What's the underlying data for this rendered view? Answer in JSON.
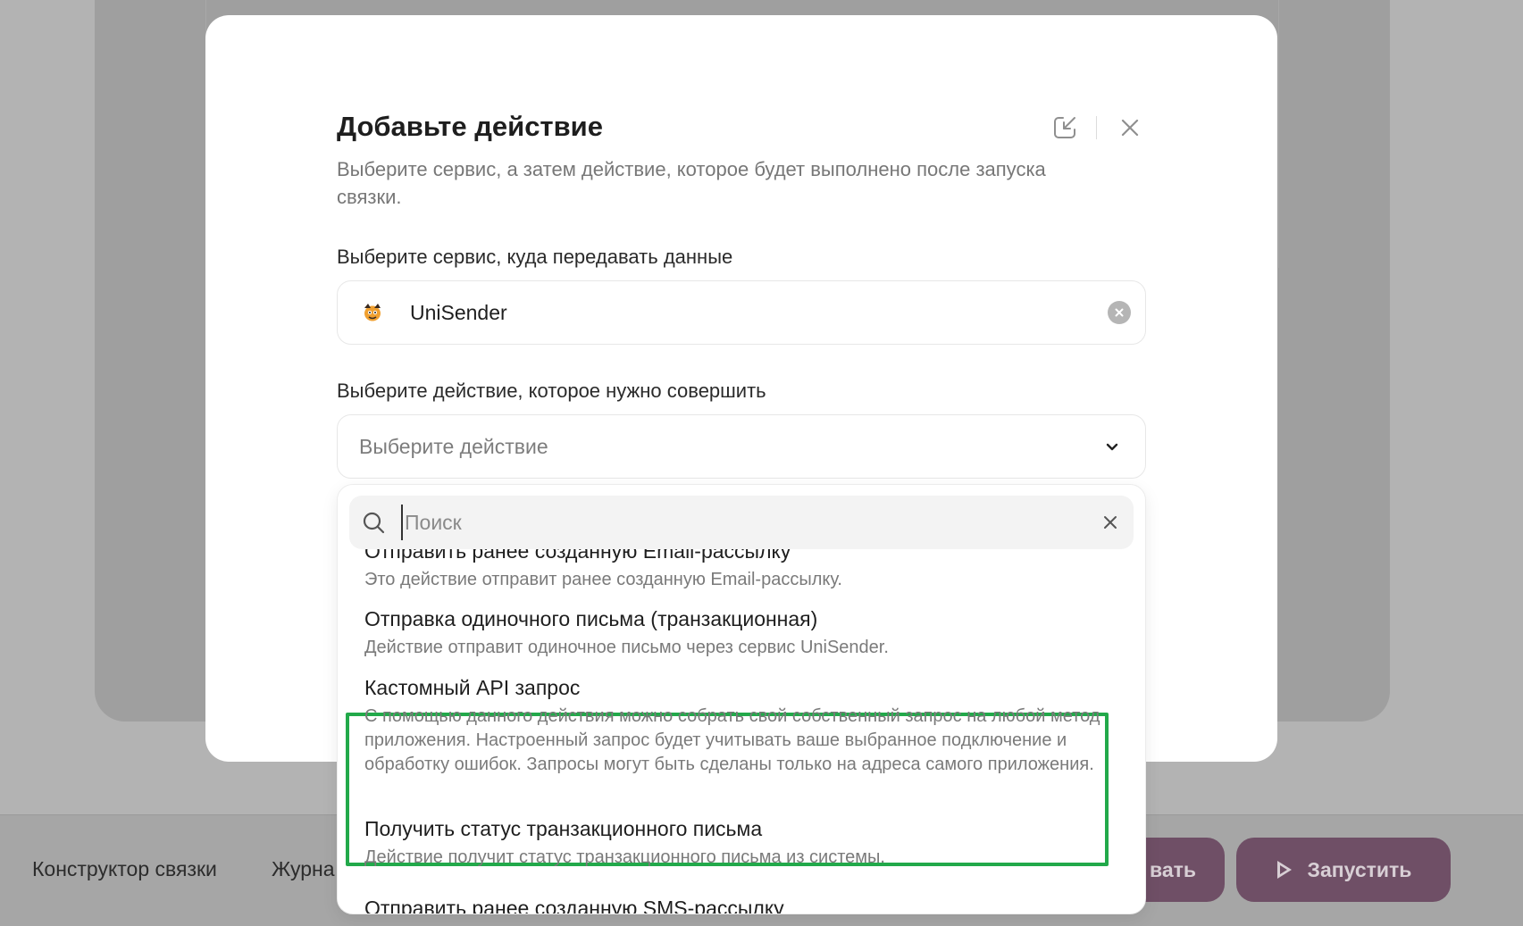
{
  "background": {
    "tabs": [
      "Конструктор связки",
      "Журна"
    ],
    "save_button_label": "вать",
    "run_button_label": "Запустить"
  },
  "modal": {
    "title": "Добавьте действие",
    "subtitle": "Выберите сервис, а затем действие, которое будет выполнено после запуска связки.",
    "service_label": "Выберите сервис, куда передавать данные",
    "service_value": "UniSender",
    "action_label": "Выберите действие, которое нужно совершить",
    "action_placeholder": "Выберите действие"
  },
  "dropdown": {
    "search_placeholder": "Поиск",
    "items": [
      {
        "title": "Отправить ранее созданную Email-рассылку",
        "description": "Это действие отправит ранее созданную Email-рассылку."
      },
      {
        "title": "Отправка одиночного письма (транзакционная)",
        "description": "Действие отправит одиночное письмо через сервис UniSender."
      },
      {
        "title": "Кастомный API запрос",
        "description": "С помощью данного действия можно собрать свой собственный запрос на любой метод приложения. Настроенный запрос будет учитывать ваше выбранное подключение и обработку ошибок. Запросы могут быть сделаны только на адреса самого приложения.",
        "highlighted": true
      },
      {
        "title": "Получить статус транзакционного письма",
        "description": "Действие получит статус транзакционного письма из системы."
      },
      {
        "title": "Отправить ранее созданную SMS-рассылку",
        "description": ""
      }
    ]
  },
  "colors": {
    "accent": "#6f4f66",
    "highlight_border": "#22a94a"
  }
}
